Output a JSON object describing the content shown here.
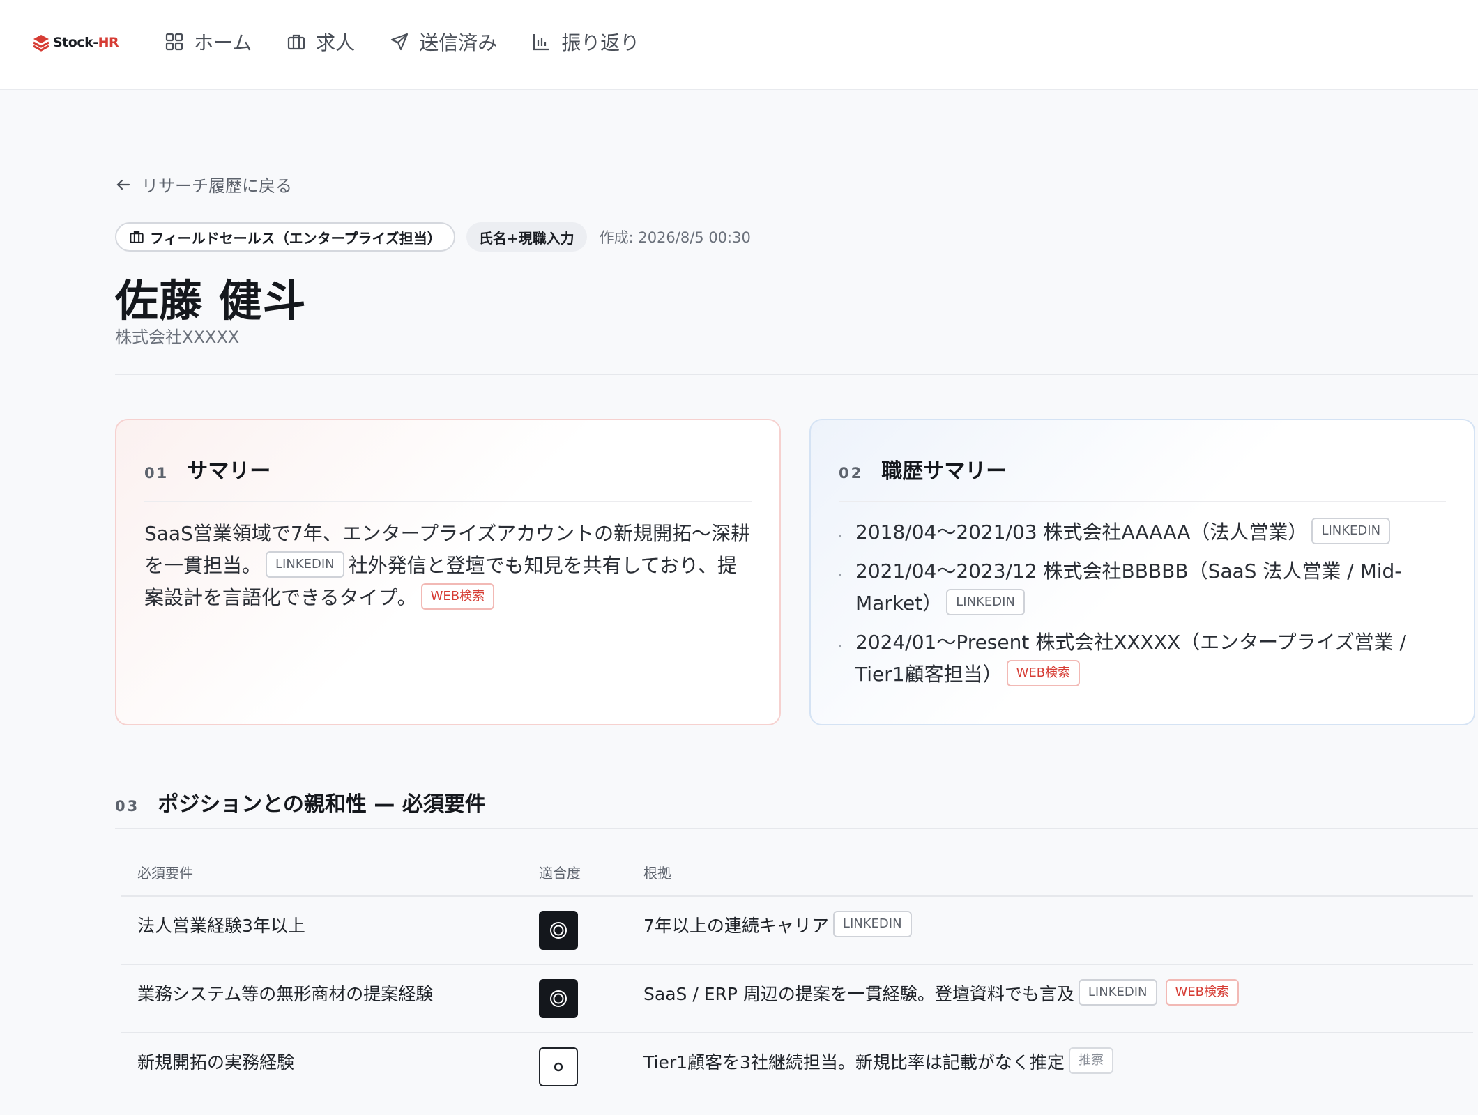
{
  "brand": {
    "name_part1": "Stock-",
    "name_part2": "HR",
    "color": "#d63c34"
  },
  "nav": [
    {
      "label": "ホーム",
      "icon": "grid-icon"
    },
    {
      "label": "求人",
      "icon": "briefcase-icon"
    },
    {
      "label": "送信済み",
      "icon": "send-icon"
    },
    {
      "label": "振り返り",
      "icon": "bar-chart-icon"
    }
  ],
  "back_label": "リサーチ履歴に戻る",
  "meta": {
    "position_chip": "フィールドセールス（エンタープライズ担当）",
    "input_chip": "氏名+現職入力",
    "created": "作成: 2026/8/5 00:30"
  },
  "candidate": {
    "name": "佐藤 健斗",
    "company": "株式会社XXXXX"
  },
  "summary": {
    "num": "01",
    "title": "サマリー",
    "text1": "SaaS営業領域で7年、エンタープライズアカウントの新規開拓〜深耕を一貫担当。",
    "tag1": "LINKEDIN",
    "text2": "社外発信と登壇でも知見を共有しており、提案設計を言語化できるタイプ。",
    "tag2": "WEB検索"
  },
  "career": {
    "num": "02",
    "title": "職歴サマリー",
    "items": [
      {
        "text": "2018/04〜2021/03 株式会社AAAAA（法人営業）",
        "tag": "LINKEDIN"
      },
      {
        "text": "2021/04〜2023/12 株式会社BBBBB（SaaS 法人営業 / Mid-Market）",
        "tag": "LINKEDIN"
      },
      {
        "text": "2024/01〜Present 株式会社XXXXX（エンタープライズ営業 / Tier1顧客担当）",
        "tag": "WEB検索"
      }
    ]
  },
  "requirements": {
    "num": "03",
    "title": "ポジションとの親和性 — 必須要件",
    "headers": {
      "req": "必須要件",
      "fit": "適合度",
      "basis": "根拠"
    },
    "rows": [
      {
        "req": "法人営業経験3年以上",
        "fit": "double-circle",
        "basis": "7年以上の連続キャリア",
        "tags": [
          "LINKEDIN"
        ]
      },
      {
        "req": "業務システム等の無形商材の提案経験",
        "fit": "double-circle",
        "basis": "SaaS / ERP 周辺の提案を一貫経験。登壇資料でも言及",
        "tags": [
          "LINKEDIN",
          "WEB検索"
        ]
      },
      {
        "req": "新規開拓の実務経験",
        "fit": "circle",
        "basis": "Tier1顧客を3社継続担当。新規比率は記載がなく推定",
        "tags": [
          "推察"
        ]
      }
    ]
  }
}
